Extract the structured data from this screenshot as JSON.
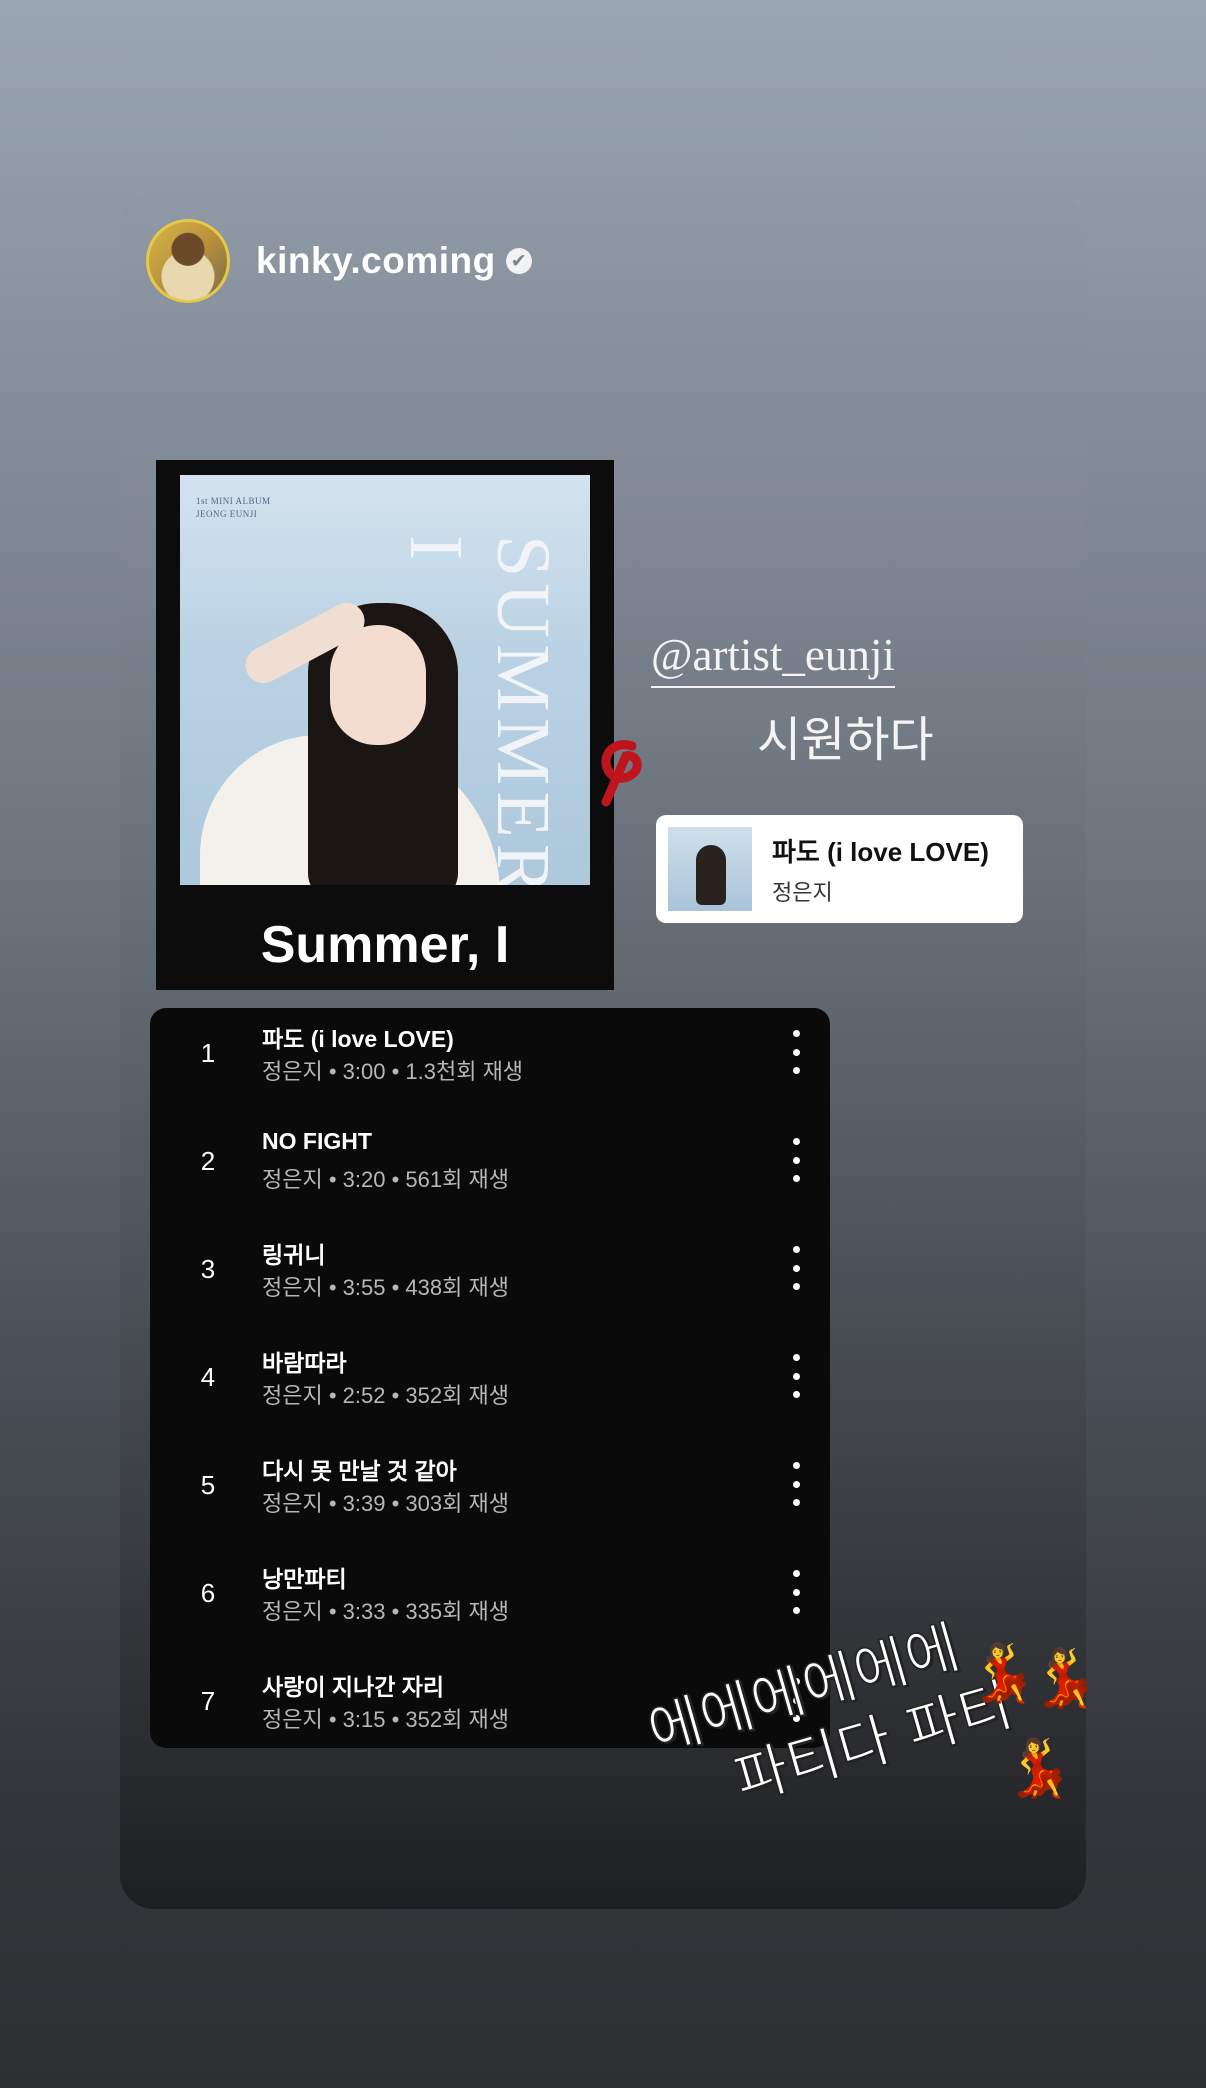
{
  "story": {
    "username": "kinky.coming",
    "verified_icon": "✔"
  },
  "album": {
    "cover_small_text_1": "1st MINI ALBUM",
    "cover_small_text_2": "JEONG EUNJI",
    "cover_title": "SUMMER, I",
    "name": "Summer, I"
  },
  "mention": {
    "handle": "@artist_eunji",
    "text": "시원하다"
  },
  "music_sticker": {
    "title": "파도 (i love LOVE)",
    "artist": "정은지"
  },
  "tracks": [
    {
      "num": "1",
      "title": "파도 (i love LOVE)",
      "meta": "정은지 • 3:00 • 1.3천회 재생"
    },
    {
      "num": "2",
      "title": "NO FIGHT",
      "meta": "정은지 • 3:20 • 561회 재생"
    },
    {
      "num": "3",
      "title": "링귀니",
      "meta": "정은지 • 3:55 • 438회 재생"
    },
    {
      "num": "4",
      "title": "바람따라",
      "meta": "정은지 • 2:52 • 352회 재생"
    },
    {
      "num": "5",
      "title": "다시 못 만날 것 같아",
      "meta": "정은지 • 3:39 • 303회 재생"
    },
    {
      "num": "6",
      "title": "낭만파티",
      "meta": "정은지 • 3:33 • 335회 재생"
    },
    {
      "num": "7",
      "title": "사랑이 지나간 자리",
      "meta": "정은지 • 3:15 • 352회 재생"
    }
  ],
  "caption": {
    "line1": "에에에에에에",
    "line2": "파티다 파티"
  },
  "emoji": {
    "dancer": "💃"
  }
}
